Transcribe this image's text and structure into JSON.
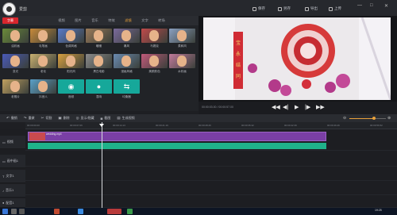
{
  "titlebar": {
    "app_name": "爱剪",
    "buttons": [
      "保存",
      "另存",
      "导出",
      "上传"
    ],
    "win_controls": [
      "—",
      "□",
      "✕"
    ]
  },
  "tabs": {
    "brand": "字幕",
    "items": [
      "视频",
      "图片",
      "音乐",
      "特效",
      "滤镜",
      "文字",
      "转场"
    ],
    "active": "滤镜"
  },
  "effects": {
    "items": [
      {
        "label": "油彩画",
        "tint": "#6a8a3a"
      },
      {
        "label": "毛笔画",
        "tint": "#c88a3a"
      },
      {
        "label": "色调风格",
        "tint": "#5a7ac8"
      },
      {
        "label": "暖暖",
        "tint": "#9a7a5a"
      },
      {
        "label": "暴风",
        "tint": "#7a6a9a"
      },
      {
        "label": "马赛克",
        "tint": "#c04a4a"
      },
      {
        "label": "柔和风",
        "tint": "#8aa0c0"
      },
      {
        "label": "变光",
        "tint": "#4a5ab8"
      },
      {
        "label": "老化",
        "tint": "#c8b070"
      },
      {
        "label": "阳光风",
        "tint": "#d8a040"
      },
      {
        "label": "黑白电影",
        "tint": "#8a8a8a"
      },
      {
        "label": "漫画风格",
        "tint": "#6a8ab0"
      },
      {
        "label": "美颜肤色",
        "tint": "#c05a7a"
      },
      {
        "label": "水彩画",
        "tint": "#c07a9a"
      },
      {
        "label": "老照片",
        "tint": "#c0a060"
      },
      {
        "label": "抖音人",
        "tint": "#5aa0c8"
      }
    ],
    "tools": [
      {
        "label": "音频",
        "glyph": "◉"
      },
      {
        "label": "混响",
        "glyph": "●"
      },
      {
        "label": "均衡器",
        "glyph": "⇆"
      }
    ]
  },
  "preview": {
    "time_text": "00:00:03.00 / 00:00:57.00",
    "controls": [
      "◀◀",
      "◀|",
      "▶",
      "|▶",
      "▶▶"
    ],
    "couplet_left": [
      "宝",
      "永",
      "结",
      "同"
    ]
  },
  "timeline_toolbar": {
    "buttons": [
      "撤销",
      "重做",
      "切割",
      "删除",
      "显示/隐藏",
      "截图",
      "生成视频"
    ],
    "icons": [
      "undo-icon",
      "redo-icon",
      "scissors-icon",
      "trash-icon",
      "eye-icon",
      "camera-icon",
      "export-icon"
    ]
  },
  "ruler": {
    "ticks": [
      "00:00:00.00",
      "00:00:07.06",
      "00:00:14.13",
      "00:00:21.19",
      "00:00:28.26",
      "00:00:35.32",
      "00:00:42.39",
      "00:00:49.46",
      "00:00:56.52"
    ]
  },
  "tracks": {
    "heads": [
      "视频",
      "画中画1",
      "文字1",
      "音乐1",
      "配音1"
    ],
    "clip_name": "wedding.mp4"
  },
  "taskbar": {
    "clock": "19:25"
  },
  "colors": {
    "accent": "#e9a13b",
    "brand_red": "#d8262d",
    "clip_purple": "#7a3fa5",
    "clip_teal": "#1fb28a",
    "tool_teal": "#16a89a"
  }
}
